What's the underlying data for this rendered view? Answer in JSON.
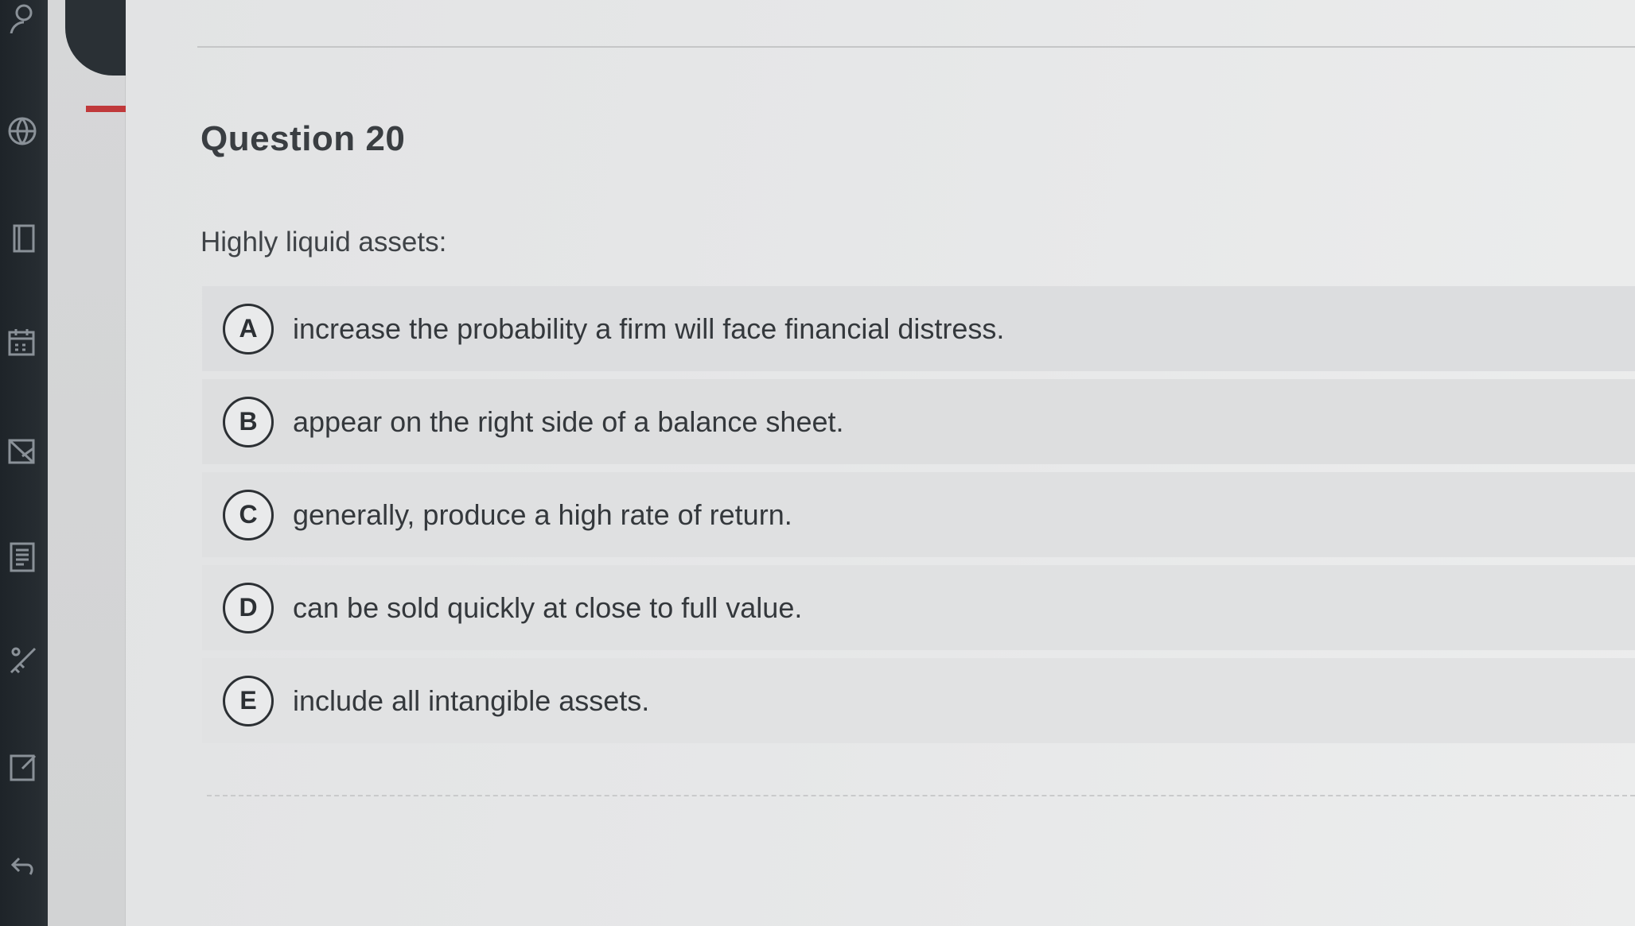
{
  "sidebar": {
    "icons": [
      "user-icon",
      "globe-icon",
      "book-icon",
      "calendar-icon",
      "inbox-icon",
      "document-icon",
      "tools-icon",
      "edit-icon",
      "back-arrow-icon"
    ]
  },
  "question": {
    "title": "Question 20",
    "prompt": "Highly liquid assets:",
    "options": [
      {
        "letter": "A",
        "text": "increase the probability a firm will face financial distress."
      },
      {
        "letter": "B",
        "text": "appear on the right side of a balance sheet."
      },
      {
        "letter": "C",
        "text": "generally, produce a high rate of return."
      },
      {
        "letter": "D",
        "text": "can be sold quickly at close to full value."
      },
      {
        "letter": "E",
        "text": "include all intangible assets."
      }
    ]
  },
  "colors": {
    "rail": "#262c31",
    "accent": "#c0393b",
    "option_bg": "#dcdddf"
  }
}
